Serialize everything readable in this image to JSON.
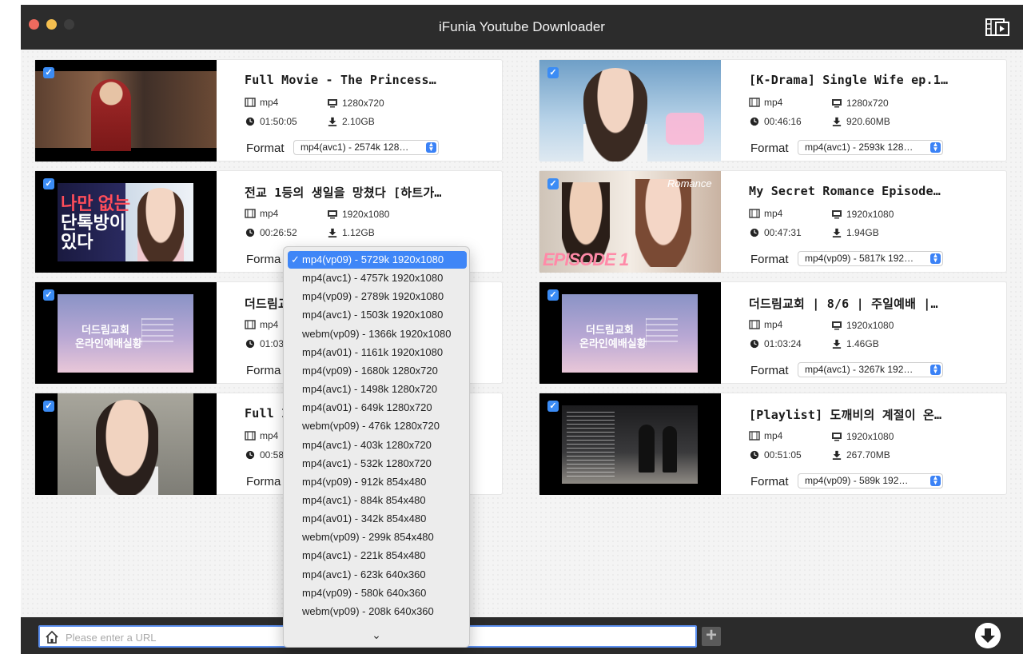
{
  "window": {
    "title": "iFunia Youtube Downloader"
  },
  "videos": [
    {
      "title": "Full Movie - The Princess…",
      "container": "mp4",
      "resolution": "1280x720",
      "duration": "01:50:05",
      "size": "2.10GB",
      "format_label": "Format",
      "format": "mp4(avc1) - 2574k 128…",
      "checked": true
    },
    {
      "title": "[K-Drama] Single Wife ep.1…",
      "container": "mp4",
      "resolution": "1280x720",
      "duration": "00:46:16",
      "size": "920.60MB",
      "format_label": "Format",
      "format": "mp4(avc1) - 2593k 128…",
      "checked": true
    },
    {
      "title": "전교 1등의 생일을 망쳤다 [하트가…",
      "container": "mp4",
      "resolution": "1920x1080",
      "duration": "00:26:52",
      "size": "1.12GB",
      "format_label": "Forma",
      "format": "",
      "checked": true
    },
    {
      "title": "My Secret Romance Episode…",
      "container": "mp4",
      "resolution": "1920x1080",
      "duration": "00:47:31",
      "size": "1.94GB",
      "format_label": "Format",
      "format": "mp4(vp09) - 5817k 192…",
      "checked": true
    },
    {
      "title": "더드림교",
      "container": "mp4",
      "resolution": "",
      "duration": "01:03",
      "size": "",
      "format_label": "Forma",
      "format": "",
      "checked": true
    },
    {
      "title": "더드림교회 | 8/6 | 주일예배 |…",
      "container": "mp4",
      "resolution": "1920x1080",
      "duration": "01:03:24",
      "size": "1.46GB",
      "format_label": "Format",
      "format": "mp4(avc1) - 3267k 192…",
      "checked": true
    },
    {
      "title": "Full I",
      "container": "mp4",
      "resolution": "",
      "duration": "00:58",
      "size": "",
      "format_label": "Forma",
      "format": "",
      "checked": true
    },
    {
      "title": "[Playlist] 도깨비의 계절이 온…",
      "container": "mp4",
      "resolution": "1920x1080",
      "duration": "00:51:05",
      "size": "267.70MB",
      "format_label": "Format",
      "format": "mp4(vp09) - 589k 192…",
      "checked": true
    }
  ],
  "thumb_text": {
    "church_line1": "더드림교회",
    "church_line2": "온라인예배실황",
    "episode": "EPISODE 1",
    "romance": "Romance",
    "korean_big": "나만 없는",
    "korean_big2": "단톡방이",
    "korean_big3": "있다"
  },
  "dropdown": {
    "selected_index": 0,
    "options": [
      "mp4(vp09) - 5729k 1920x1080",
      "mp4(avc1) - 4757k 1920x1080",
      "mp4(vp09) - 2789k 1920x1080",
      "mp4(avc1) - 1503k 1920x1080",
      "webm(vp09) - 1366k 1920x1080",
      "mp4(av01) - 1161k 1920x1080",
      "mp4(vp09) - 1680k 1280x720",
      "mp4(avc1) - 1498k 1280x720",
      "mp4(av01) - 649k 1280x720",
      "webm(vp09) - 476k 1280x720",
      "mp4(avc1) - 403k 1280x720",
      "mp4(avc1) - 532k 1280x720",
      "mp4(vp09) - 912k 854x480",
      "mp4(avc1) - 884k 854x480",
      "mp4(av01) - 342k 854x480",
      "webm(vp09) - 299k 854x480",
      "mp4(avc1) - 221k 854x480",
      "mp4(avc1) - 623k 640x360",
      "mp4(vp09) - 580k 640x360",
      "webm(vp09) - 208k 640x360"
    ],
    "check_mark": "✓",
    "scroll_down": "⌄"
  },
  "url_bar": {
    "placeholder": "Please enter a URL",
    "value": ""
  },
  "add_label": "+",
  "colors": {
    "accent": "#3f86f7",
    "titlebar": "#2c2c2c",
    "close": "#ed6a5e",
    "minimize": "#f5bf4f",
    "zoom": "#3d3d3d"
  }
}
